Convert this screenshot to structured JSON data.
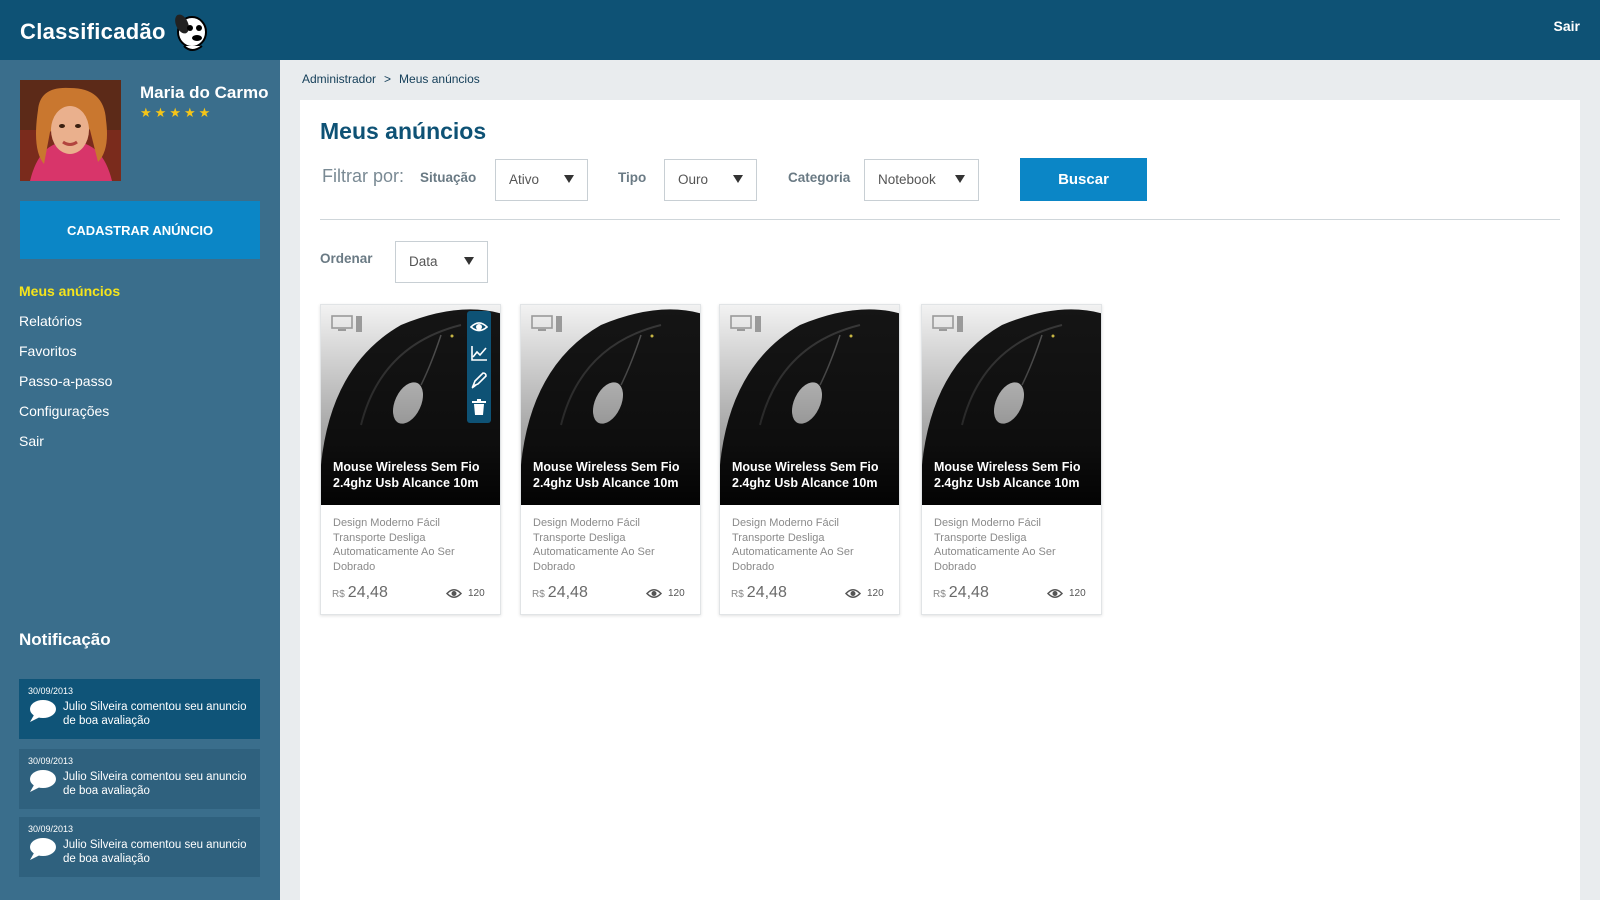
{
  "header": {
    "logo_text": "Classificadão",
    "logout_label": "Sair"
  },
  "user": {
    "name": "Maria do Carmo",
    "rating": 5,
    "rating_stars": "★★★★★"
  },
  "sidebar": {
    "cta_label": "CADASTRAR ANÚNCIO",
    "menu": [
      {
        "label": "Meus anúncios",
        "active": true
      },
      {
        "label": "Relatórios",
        "active": false
      },
      {
        "label": "Favoritos",
        "active": false
      },
      {
        "label": "Passo-a-passo",
        "active": false
      },
      {
        "label": "Configurações",
        "active": false
      },
      {
        "label": "Sair",
        "active": false
      }
    ],
    "notifications_title": "Notificação",
    "notifications": [
      {
        "date": "30/09/2013",
        "text": "Julio Silveira comentou seu anuncio de boa avaliação"
      },
      {
        "date": "30/09/2013",
        "text": "Julio Silveira comentou seu anuncio de boa avaliação"
      },
      {
        "date": "30/09/2013",
        "text": "Julio Silveira comentou seu anuncio de boa avaliação"
      }
    ]
  },
  "breadcrumb": {
    "items": [
      "Administrador",
      "Meus anúncios"
    ],
    "separator": ">"
  },
  "main": {
    "title": "Meus anúncios",
    "filter_label": "Filtrar por:",
    "filters": {
      "situacao": {
        "label": "Situação",
        "value": "Ativo"
      },
      "tipo": {
        "label": "Tipo",
        "value": "Ouro"
      },
      "categoria": {
        "label": "Categoria",
        "value": "Notebook"
      }
    },
    "search_label": "Buscar",
    "sort": {
      "label": "Ordenar",
      "value": "Data"
    }
  },
  "listings": [
    {
      "title": "Mouse Wireless Sem Fio 2.4ghz Usb Alcance 10m",
      "description": "Design Moderno Fácil Transporte Desliga Automaticamente Ao Ser Dobrado",
      "currency": "R$",
      "price": "24,48",
      "views": "120",
      "icon": "computer-icon"
    },
    {
      "title": "Mouse Wireless Sem Fio 2.4ghz Usb Alcance 10m",
      "description": "Design Moderno Fácil Transporte Desliga Automaticamente Ao Ser Dobrado",
      "currency": "R$",
      "price": "24,48",
      "views": "120",
      "icon": "computer-icon"
    },
    {
      "title": "Mouse Wireless Sem Fio 2.4ghz Usb Alcance 10m",
      "description": "Design Moderno Fácil Transporte Desliga Automaticamente Ao Ser Dobrado",
      "currency": "R$",
      "price": "24,48",
      "views": "120",
      "icon": "computer-icon"
    },
    {
      "title": "Mouse Wireless Sem Fio 2.4ghz Usb Alcance 10m",
      "description": "Design Moderno Fácil Transporte Desliga Automaticamente Ao Ser Dobrado",
      "currency": "R$",
      "price": "24,48",
      "views": "120",
      "icon": "computer-icon"
    }
  ],
  "card_actions": [
    "view-icon",
    "chart-icon",
    "edit-icon",
    "trash-icon"
  ],
  "colors": {
    "header_bg": "#0e5275",
    "sidebar_bg": "#3a6e8c",
    "accent": "#0b86c6",
    "active_menu": "#f5e41c",
    "stars": "#f5c518"
  }
}
